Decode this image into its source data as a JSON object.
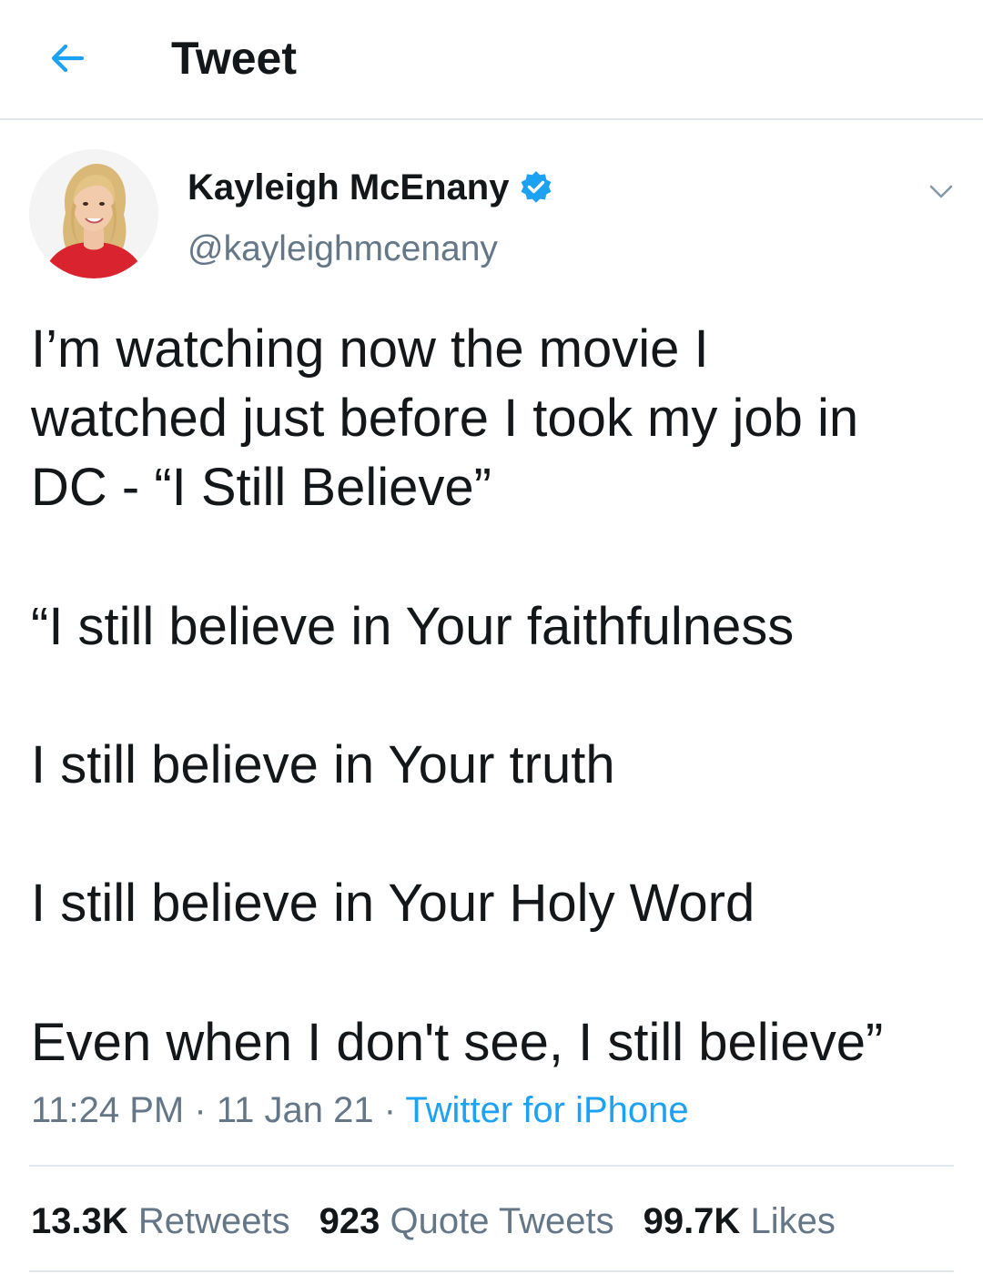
{
  "header": {
    "title": "Tweet",
    "back_icon": "arrow-left-icon"
  },
  "tweet": {
    "author": {
      "name": "Kayleigh McEnany",
      "handle": "@kayleighmcenany",
      "verified": true
    },
    "text_lines": [
      "I’m watching now the movie I",
      "watched just before I took my job in",
      "DC - “I Still Believe”",
      "“I still believe in Your faithfulness",
      "I still believe in Your truth",
      "I still believe in Your Holy Word",
      "Even when I don't see, I still believe”"
    ],
    "time": "11:24 PM",
    "date": "11 Jan 21",
    "separator": "·",
    "source": "Twitter for iPhone"
  },
  "stats": {
    "retweets_count": "13.3K",
    "retweets_label": "Retweets",
    "quotes_count": "923",
    "quotes_label": "Quote Tweets",
    "likes_count": "99.7K",
    "likes_label": "Likes"
  },
  "colors": {
    "accent": "#1da1f2",
    "text": "#14171a",
    "secondary": "#657786",
    "divider": "#e1e8ed"
  }
}
